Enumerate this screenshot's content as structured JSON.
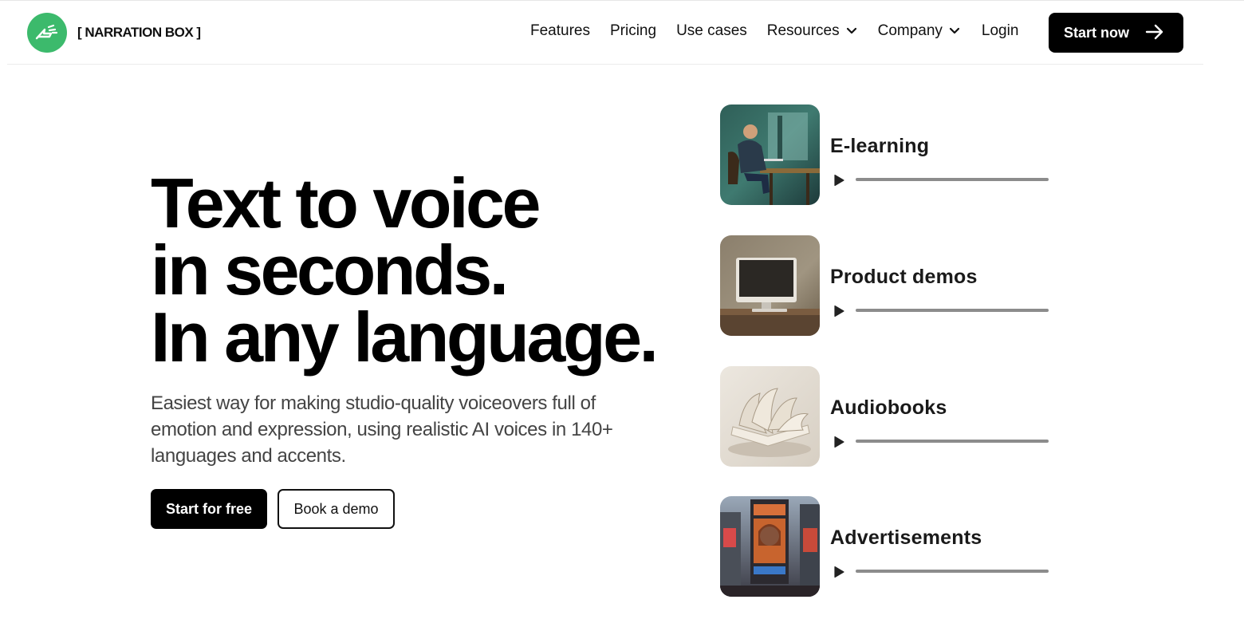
{
  "brand": {
    "name": "[ NARRATION BOX ]",
    "accent_color": "#3cba6c",
    "logo_icon": "megaphone-icon"
  },
  "nav": {
    "features": "Features",
    "pricing": "Pricing",
    "use_cases": "Use cases",
    "resources": "Resources",
    "company": "Company",
    "login": "Login",
    "cta": "Start now"
  },
  "hero": {
    "title_line1": "Text to voice",
    "title_line2": "in seconds.",
    "title_line3": "In any language.",
    "subtitle": "Easiest way for making studio-quality voiceovers full of emotion and expression, using realistic AI voices in 140+ languages and accents.",
    "primary_button": "Start for free",
    "secondary_button": "Book a demo"
  },
  "use_cases": [
    {
      "label": "E-learning",
      "image": "person-at-laptop-painting"
    },
    {
      "label": "Product demos",
      "image": "computer-monitor-painting"
    },
    {
      "label": "Audiobooks",
      "image": "open-book-sculpture"
    },
    {
      "label": "Advertisements",
      "image": "city-billboard-photo"
    }
  ]
}
